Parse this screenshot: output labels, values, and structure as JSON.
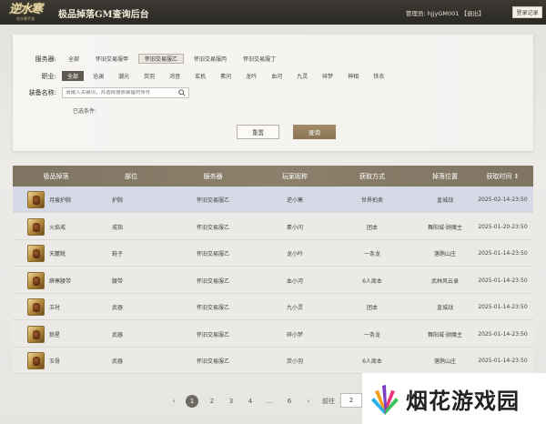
{
  "header": {
    "logo_main": "逆水寒",
    "logo_sub": "逆水寒手游",
    "title": "极品掉落GM查询后台",
    "admin_label": "管理员: hjjy",
    "admin_id": "GM001",
    "logout": "【退出】",
    "log_button": "登录记录"
  },
  "filters": {
    "server_label": "服务器:",
    "servers": [
      "全部",
      "怀旧交易服甲",
      "怀旧交易服乙",
      "怀旧交易服丙",
      "怀旧交易服丁"
    ],
    "server_selected": "怀旧交易服乙",
    "class_label": "职业:",
    "classes": [
      "全部",
      "沧澜",
      "潮光",
      "荧羽",
      "鸿音",
      "玄机",
      "素问",
      "龙吟",
      "血河",
      "九灵",
      "碎梦",
      "神相",
      "铁衣"
    ],
    "class_selected": "全部",
    "equip_label": "装备名称:",
    "equip_placeholder": "请输入关键词，并选择搜索装备的条件",
    "selected_conditions": "已选条件:",
    "reset_button": "重置",
    "query_button": "查询"
  },
  "table": {
    "columns": [
      "极品掉落",
      "部位",
      "服务器",
      "玩家昵称",
      "获取方式",
      "掉落位置",
      "获取时间 ↕"
    ],
    "rows": [
      {
        "name": "月痕护腕",
        "slot": "护腕",
        "server": "怀旧交易服乙",
        "player": "逆小寒",
        "method": "世界拍卖",
        "location": "皇城战",
        "time": "2025-02-14-23:50"
      },
      {
        "name": "火焰戒",
        "slot": "戒指",
        "server": "怀旧交易服乙",
        "player": "素小问",
        "method": "团本",
        "location": "舞阳城·顾魔主",
        "time": "2025-01-20-23:50"
      },
      {
        "name": "天麓靴",
        "slot": "鞋子",
        "server": "怀旧交易服乙",
        "player": "龙小吟",
        "method": "一条龙",
        "location": "落鹘山庄",
        "time": "2025-01-14-23:50"
      },
      {
        "name": "薛寒腰带",
        "slot": "腰带",
        "server": "怀旧交易服乙",
        "player": "血小河",
        "method": "6人周本",
        "location": "武林风云录",
        "time": "2025-01-14-23:50"
      },
      {
        "name": "玉衬",
        "slot": "武器",
        "server": "怀旧交易服乙",
        "player": "九小灵",
        "method": "团本",
        "location": "皇城战",
        "time": "2025-01-14-23:50"
      },
      {
        "name": "狼星",
        "slot": "武器",
        "server": "怀旧交易服乙",
        "player": "碎小梦",
        "method": "一条龙",
        "location": "舞阳城·顾魔主",
        "time": "2025-01-14-23:50"
      },
      {
        "name": "玉骨",
        "slot": "武器",
        "server": "怀旧交易服乙",
        "player": "荧小羽",
        "method": "6人周本",
        "location": "落鹘山庄",
        "time": "2025-01-14-23:50"
      }
    ]
  },
  "pagination": {
    "prev": "‹",
    "pages": [
      "1",
      "2",
      "3",
      "4",
      "…",
      "6"
    ],
    "current": "1",
    "next": "›",
    "goto_label": "前往",
    "goto_value": "2"
  },
  "watermark": {
    "text": "烟花游戏园"
  }
}
